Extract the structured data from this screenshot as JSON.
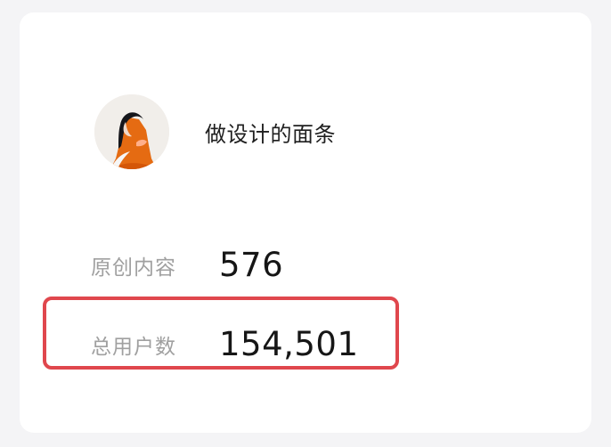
{
  "profile": {
    "username": "做设计的面条"
  },
  "stats": [
    {
      "label": "原创内容",
      "value": "576"
    },
    {
      "label": "总用户数",
      "value": "154,501"
    }
  ],
  "icons": {
    "avatar": "profile-photo-icon"
  },
  "colors": {
    "highlight_border": "#e0474d",
    "label_text": "#a0a0a0",
    "value_text": "#161616",
    "background": "#f4f4f6",
    "card": "#ffffff"
  }
}
